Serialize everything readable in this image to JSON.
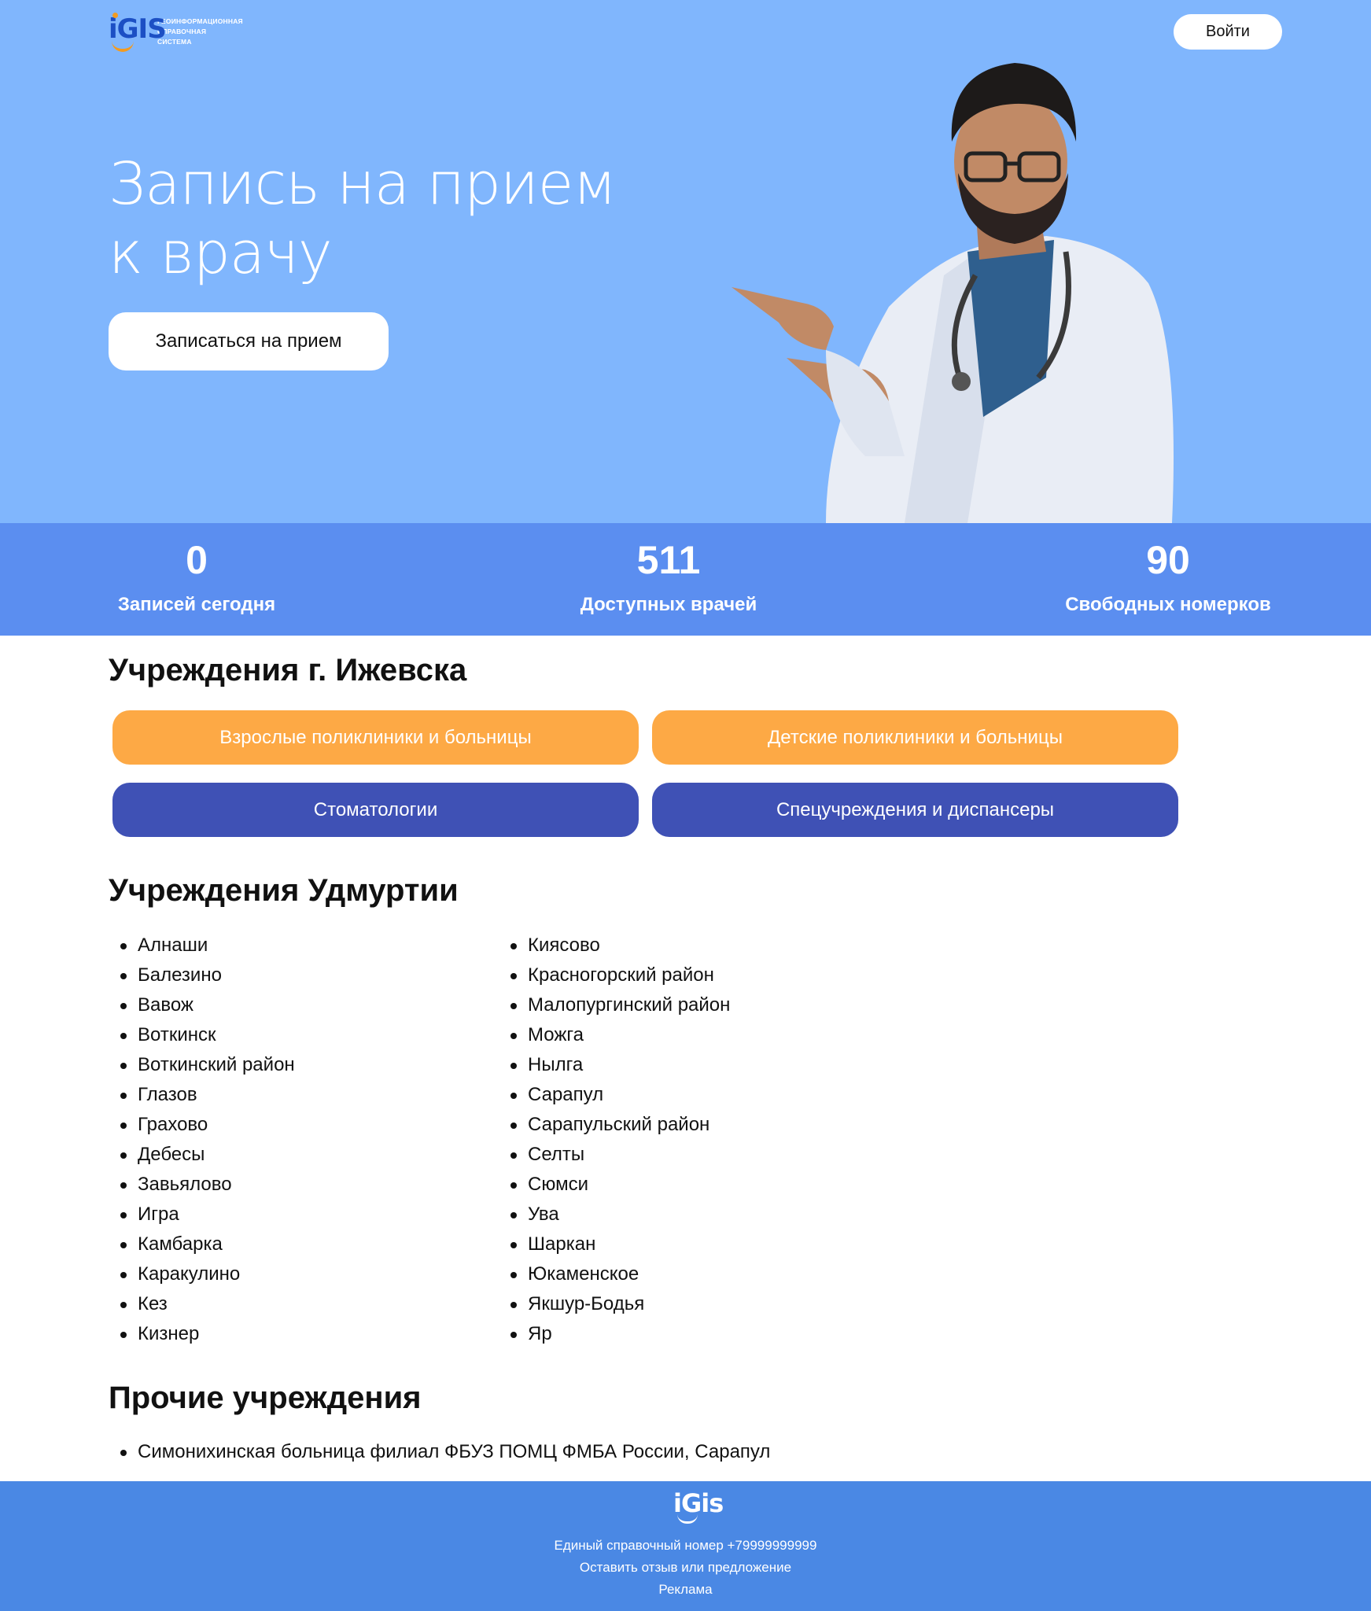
{
  "header": {
    "logo_letters": "iGIS",
    "logo_caption": [
      "Геоинформационная",
      "справочная",
      "система"
    ],
    "login_label": "Войти"
  },
  "hero": {
    "title_line1": "Запись на прием",
    "title_line2": "к врачу",
    "cta_label": "Записаться на прием",
    "background_color": "#80b6fd"
  },
  "stats": [
    {
      "value": "0",
      "label": "Записей сегодня"
    },
    {
      "value": "511",
      "label": "Доступных врачей"
    },
    {
      "value": "90",
      "label": "Свободных номерков"
    }
  ],
  "izhevsk": {
    "title": "Учреждения г. Ижевска",
    "categories": [
      {
        "label": "Взрослые поликлиники и больницы",
        "color": "#fda945"
      },
      {
        "label": "Детские поликлиники и больницы",
        "color": "#fda945"
      },
      {
        "label": "Стоматологии",
        "color": "#3f51b5"
      },
      {
        "label": "Спецучреждения и диспансеры",
        "color": "#3f51b5"
      }
    ]
  },
  "udmurtia": {
    "title": "Учреждения Удмуртии",
    "column1": [
      "Алнаши",
      "Балезино",
      "Вавож",
      "Воткинск",
      "Воткинский район",
      "Глазов",
      "Грахово",
      "Дебесы",
      "Завьялово",
      "Игра",
      "Камбарка",
      "Каракулино",
      "Кез",
      "Кизнер"
    ],
    "column2": [
      "Киясово",
      "Красногорский район",
      "Малопургинский район",
      "Можга",
      "Нылга",
      "Сарапул",
      "Сарапульский район",
      "Селты",
      "Сюмси",
      "Ува",
      "Шаркан",
      "Юкаменское",
      "Якшур-Бодья",
      "Яр"
    ]
  },
  "other": {
    "title": "Прочие учреждения",
    "items": [
      "Симонихинская больница филиал ФБУЗ ПОМЦ ФМБА России, Сарапул"
    ]
  },
  "footer": {
    "logo_letters": "iGis",
    "phone_line": "Единый справочный номер +79999999999",
    "feedback_link": "Оставить отзыв или предложение",
    "ads_link": "Реклама"
  }
}
